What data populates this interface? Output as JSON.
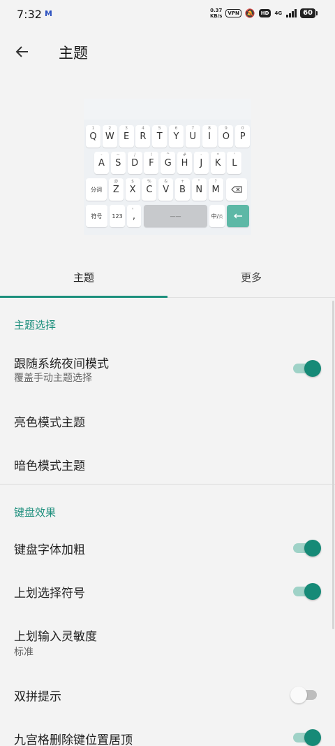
{
  "status_bar": {
    "time": "7:32",
    "mail_icon": "M",
    "net_speed_value": "0.37",
    "net_speed_unit": "KB/s",
    "vpn": "VPN",
    "hd": "HD",
    "network_type": "4G",
    "battery": "60"
  },
  "app_bar": {
    "title": "主题"
  },
  "keyboard_preview": {
    "row1": [
      {
        "label": "Q",
        "hint": "1"
      },
      {
        "label": "W",
        "hint": "2"
      },
      {
        "label": "E",
        "hint": "3"
      },
      {
        "label": "R",
        "hint": "4"
      },
      {
        "label": "T",
        "hint": "5"
      },
      {
        "label": "Y",
        "hint": "6"
      },
      {
        "label": "U",
        "hint": "7"
      },
      {
        "label": "I",
        "hint": "8"
      },
      {
        "label": "O",
        "hint": "9"
      },
      {
        "label": "P",
        "hint": "0"
      }
    ],
    "row2": [
      {
        "label": "A",
        "hint": "-"
      },
      {
        "label": "S",
        "hint": "~"
      },
      {
        "label": "D",
        "hint": "/"
      },
      {
        "label": "F",
        "hint": "!"
      },
      {
        "label": "G",
        "hint": "^"
      },
      {
        "label": "H",
        "hint": "#"
      },
      {
        "label": "J",
        "hint": "-"
      },
      {
        "label": "K",
        "hint": "*"
      },
      {
        "label": "L",
        "hint": "'"
      }
    ],
    "row3": [
      {
        "label": "分词",
        "hint": ""
      },
      {
        "label": "Z",
        "hint": "@"
      },
      {
        "label": "X",
        "hint": "$"
      },
      {
        "label": "C",
        "hint": "%"
      },
      {
        "label": "V",
        "hint": "&"
      },
      {
        "label": "B",
        "hint": "+"
      },
      {
        "label": "N",
        "hint": "\""
      },
      {
        "label": "M",
        "hint": "?"
      }
    ],
    "row4": {
      "symbols": "符号",
      "numbers": "123",
      "comma": ",",
      "comma_hint": "。",
      "space": "——",
      "lang": "中/",
      "lang_sub": "英"
    }
  },
  "tabs": [
    {
      "label": "主题"
    },
    {
      "label": "更多"
    }
  ],
  "sections": {
    "theme": {
      "header": "主题选择",
      "follow_night": {
        "title": "跟随系统夜间模式",
        "subtitle": "覆盖手动主题选择",
        "enabled": true
      },
      "light_theme": {
        "title": "亮色模式主题"
      },
      "dark_theme": {
        "title": "暗色模式主题"
      }
    },
    "keyboard": {
      "header": "键盘效果",
      "bold_font": {
        "title": "键盘字体加粗",
        "enabled": true
      },
      "swipe_symbol": {
        "title": "上划选择符号",
        "enabled": true
      },
      "swipe_sensitivity": {
        "title": "上划输入灵敏度",
        "subtitle": "标准"
      },
      "shuangpin_hint": {
        "title": "双拼提示",
        "enabled": false
      },
      "nine_grid_delete": {
        "title": "九宫格删除键位置居顶",
        "enabled": true
      }
    }
  },
  "colors": {
    "accent": "#1c8f7c",
    "switch_track_on": "#9fd2c7",
    "enter_key": "#5db8a6"
  }
}
